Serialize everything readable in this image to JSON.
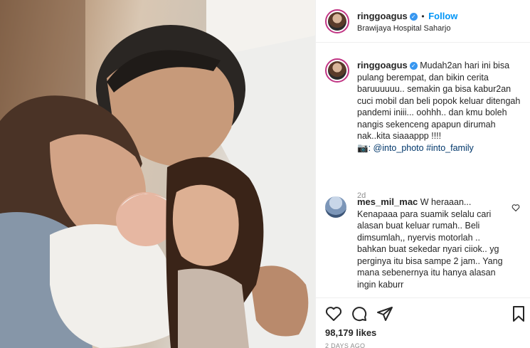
{
  "post": {
    "username": "ringgoagus",
    "follow_label": "Follow",
    "location": "Brawijaya Hospital Saharjo",
    "separator": "•",
    "verified_mark": "✓"
  },
  "caption": {
    "username": "ringgoagus",
    "text": "Mudah2an hari ini bisa pulang berempat, dan bikin cerita baruuuuuu.. semakin ga bisa kabur2an cuci mobil dan beli popok keluar ditengah pandemi iniii... oohhh.. dan kmu boleh nangis sekenceng apapun dirumah nak..kita siaaappp !!!!",
    "camera_emoji": "📷",
    "tags": ": @into_photo #into_family",
    "time": "2d"
  },
  "comment": {
    "username": "mes_mil_mac",
    "text": "W heraaan... Kenapaaa para suamik selalu cari alasan buat keluar rumah.. Beli dimsumlah,, nyervis motorlah .. bahkan buat sekedar nyari ciiok.. yg perginya itu bisa sampe 2 jam.. Yang mana sebenernya itu hanya alasan ingin kaburr"
  },
  "footer": {
    "likes": "98,179 likes",
    "date": "2 DAYS AGO"
  },
  "icons": {
    "like": "heart-icon",
    "comment": "comment-icon",
    "share": "paper-plane-icon",
    "save": "bookmark-icon"
  },
  "colors": {
    "follow": "#0095f6",
    "verified": "#3897f0",
    "muted": "#8e8e8e",
    "tag": "#00376b"
  }
}
